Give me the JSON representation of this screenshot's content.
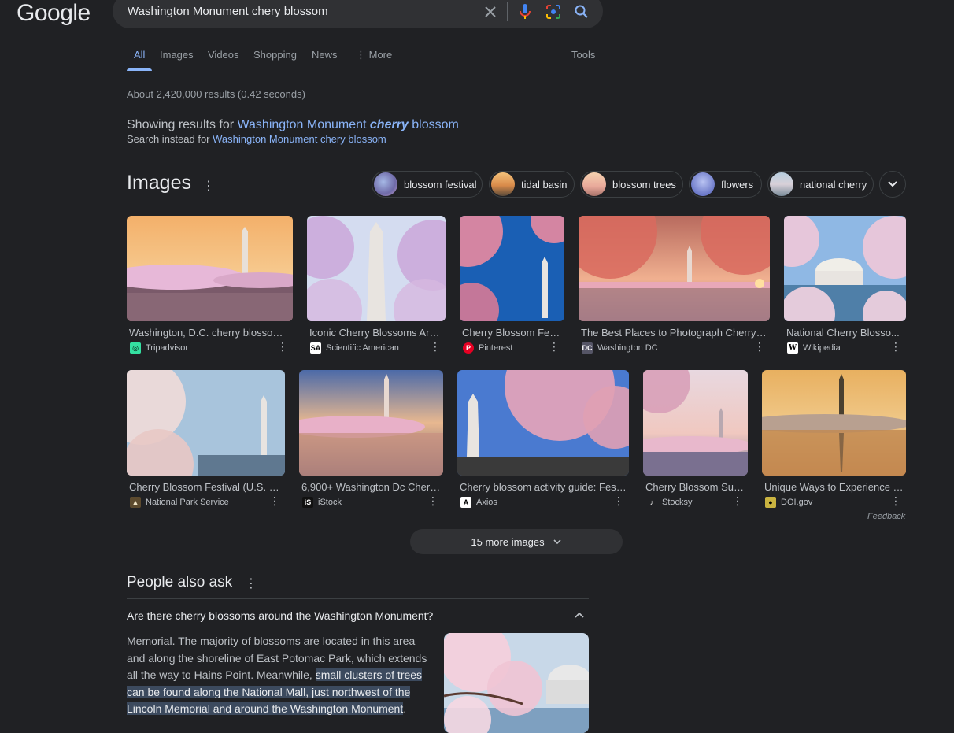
{
  "header": {
    "logo": "Google",
    "search_query": "Washington Monument chery blossom"
  },
  "tabs": [
    {
      "label": "All"
    },
    {
      "label": "Images"
    },
    {
      "label": "Videos"
    },
    {
      "label": "Shopping"
    },
    {
      "label": "News"
    },
    {
      "label": "⋮ More"
    },
    {
      "label": "Tools"
    }
  ],
  "stats": "About 2,420,000 results (0.42 seconds)",
  "correction": {
    "showing_prefix": "Showing results for",
    "showing_link_a": "Washington Monument",
    "showing_link_b": "cherry",
    "showing_link_c": "blossom",
    "instead_prefix": "Search instead for",
    "instead_link": "Washington Monument chery blossom"
  },
  "images_section": {
    "title": "Images",
    "chips": [
      {
        "label": "blossom festival"
      },
      {
        "label": "tidal basin"
      },
      {
        "label": "blossom trees"
      },
      {
        "label": "flowers"
      },
      {
        "label": "national cherry"
      }
    ],
    "cards": [
      {
        "caption": "Washington, D.C. cherry blossoms...",
        "source": "Tripadvisor"
      },
      {
        "caption": "Iconic Cherry Blossoms Are ...",
        "source": "Scientific American"
      },
      {
        "caption": "Cherry Blossom Fes...",
        "source": "Pinterest"
      },
      {
        "caption": "The Best Places to Photograph Cherry B...",
        "source": "Washington DC"
      },
      {
        "caption": "National Cherry Blosso...",
        "source": "Wikipedia"
      },
      {
        "caption": "Cherry Blossom Festival (U.S. Na...",
        "source": "National Park Service"
      },
      {
        "caption": "6,900+ Washington Dc Cherr...",
        "source": "iStock"
      },
      {
        "caption": "Cherry blossom activity guide: Fest...",
        "source": "Axios"
      },
      {
        "caption": "Cherry Blossom Sun...",
        "source": "Stocksy"
      },
      {
        "caption": "Unique Ways to Experience D...",
        "source": "DOI.gov"
      }
    ],
    "feedback": "Feedback",
    "more_images": "15 more images"
  },
  "people_also_ask": {
    "title": "People also ask",
    "question": "Are there cherry blossoms around the Washington Monument?",
    "answer_plain": "Memorial. The majority of blossoms are located in this area and along the shoreline of East Potomac Park, which extends all the way to Hains Point. Meanwhile, ",
    "answer_highlight": "small clusters of trees can be found along the National Mall, just northwest of the Lincoln Memorial and around the Washington Monument",
    "answer_end": "."
  },
  "colors": {
    "background": "#202124",
    "link": "#8ab4f8",
    "text": "#bdc1c6"
  }
}
